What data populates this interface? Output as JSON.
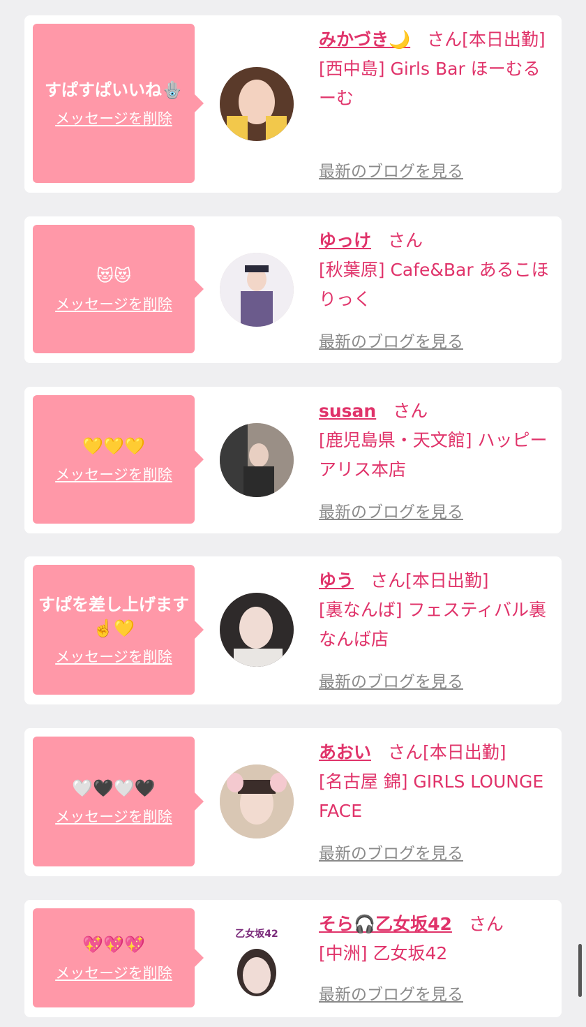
{
  "cards": [
    {
      "message": "すぱすぱいいね🪬",
      "delete_label": "メッセージを削除",
      "name": "みかづき🌙",
      "honorific": "さん",
      "status": "[本日出勤]",
      "shop": "[西中島] Girls Bar ほーむるーむ",
      "blog_link": "最新のブログを見る",
      "avatar_icon": "avatar-photo"
    },
    {
      "message": "😻😻",
      "delete_label": "メッセージを削除",
      "name": "ゆっけ",
      "honorific": "さん",
      "status": "",
      "shop": "[秋葉原] Cafe&Bar あるこほりっく",
      "blog_link": "最新のブログを見る",
      "avatar_icon": "avatar-photo"
    },
    {
      "message": "💛💛💛",
      "delete_label": "メッセージを削除",
      "name": "susan",
      "honorific": "さん",
      "status": "",
      "shop": "[鹿児島県・天文館] ハッピーアリス本店",
      "blog_link": "最新のブログを見る",
      "avatar_icon": "avatar-photo"
    },
    {
      "message": "すぱを差し上げます☝️💛",
      "delete_label": "メッセージを削除",
      "name": "ゆう",
      "honorific": "さん",
      "status": "[本日出勤]",
      "shop": "[裏なんば] フェスティバル裏なんば店",
      "blog_link": "最新のブログを見る",
      "avatar_icon": "avatar-photo"
    },
    {
      "message": "🤍🖤🤍🖤",
      "delete_label": "メッセージを削除",
      "name": "あおい",
      "honorific": "さん",
      "status": "[本日出勤]",
      "shop": "[名古屋 錦] GIRLS LOUNGE FACE",
      "blog_link": "最新のブログを見る",
      "avatar_icon": "avatar-photo"
    },
    {
      "message": "💖💖💖",
      "delete_label": "メッセージを削除",
      "name": "そら🎧乙女坂42",
      "honorific": "さん",
      "status": "",
      "shop": "[中洲] 乙女坂42",
      "blog_link": "最新のブログを見る",
      "avatar_icon": "avatar-photo",
      "avatar_caption": "乙女坂42"
    }
  ],
  "colors": {
    "accent": "#e0336a",
    "bubble": "#ff98a8",
    "page_bg": "#efeff1",
    "link_gray": "#8a8a8a"
  }
}
